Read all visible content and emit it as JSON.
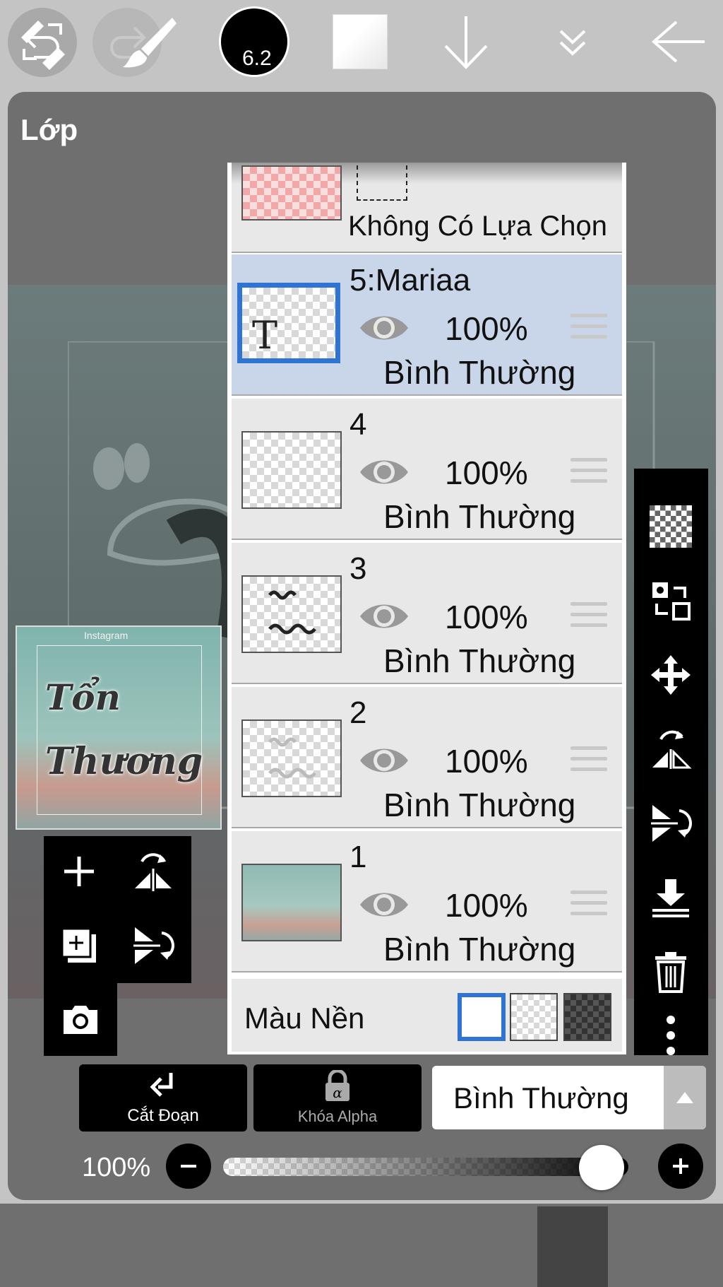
{
  "header": {
    "undo_icon": "undo-icon",
    "redo_icon": "redo-icon"
  },
  "panel": {
    "title": "Lớp"
  },
  "selection_row": {
    "label": "Không Có Lựa Chọn"
  },
  "layers": [
    {
      "name": "5:Mariaa",
      "opacity": "100%",
      "blend": "Bình Thường",
      "selected": true,
      "thumb_text": "T"
    },
    {
      "name": "4",
      "opacity": "100%",
      "blend": "Bình Thường",
      "selected": false,
      "thumb_text": ""
    },
    {
      "name": "3",
      "opacity": "100%",
      "blend": "Bình Thường",
      "selected": false,
      "thumb_text": ""
    },
    {
      "name": "2",
      "opacity": "100%",
      "blend": "Bình Thường",
      "selected": false,
      "thumb_text": ""
    },
    {
      "name": "1",
      "opacity": "100%",
      "blend": "Bình Thường",
      "selected": false,
      "thumb_text": ""
    }
  ],
  "background_row": {
    "label": "Màu Nền",
    "selected": "white"
  },
  "preview": {
    "insta": "Instagram",
    "word1": "Tổn",
    "word2": "Thương"
  },
  "bottom_controls": {
    "clipping_label": "Cắt Đoạn",
    "alpha_lock_label": "Khóa Alpha",
    "blend_mode": "Bình Thường",
    "opacity_label": "100%",
    "opacity_value": 1.0
  },
  "bottom_bar": {
    "brush_size": "6.2"
  },
  "colors": {
    "accent": "#2f73d3",
    "selected_row": "#c9d6ea",
    "panel": "#6f6f6f"
  }
}
